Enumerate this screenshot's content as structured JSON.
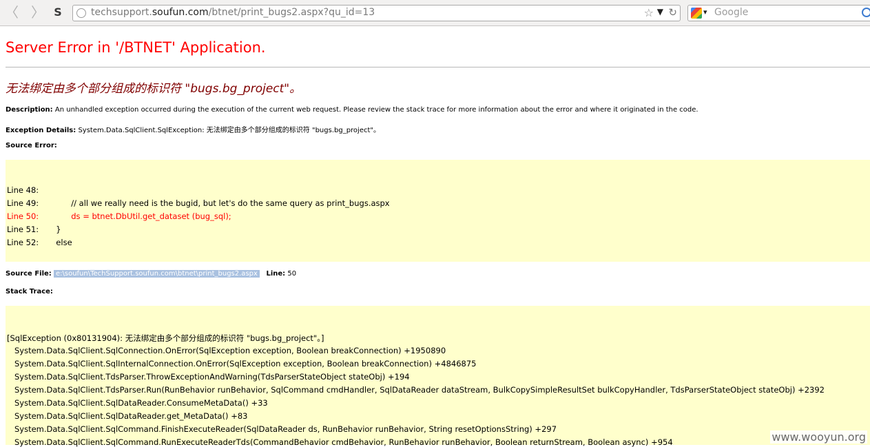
{
  "browser": {
    "url_prefix": "techsupport.",
    "url_host": "soufun.com",
    "url_path": "/btnet/print_bugs2.aspx?qu_id=13",
    "search_placeholder": "Google",
    "back_icon": "back-arrow-icon",
    "forward_icon": "forward-arrow-icon"
  },
  "page": {
    "title": "Server Error in '/BTNET' Application.",
    "error_heading": "无法绑定由多个部分组成的标识符 \"bugs.bg_project\"。",
    "description_label": "Description:",
    "description_text": "An unhandled exception occurred during the execution of the current web request. Please review the stack trace for more information about the error and where it originated in the code.",
    "exception_label": "Exception Details:",
    "exception_text": "System.Data.SqlClient.SqlException: 无法绑定由多个部分组成的标识符 \"bugs.bg_project\"。",
    "source_error_label": "Source Error:",
    "source_lines": [
      {
        "num": "Line 48:",
        "code": ""
      },
      {
        "num": "Line 49:",
        "code": "        // all we really need is the bugid, but let's do the same query as print_bugs.aspx"
      },
      {
        "num": "Line 50:",
        "code": "        ds = btnet.DbUtil.get_dataset (bug_sql);"
      },
      {
        "num": "Line 51:",
        "code": "  }"
      },
      {
        "num": "Line 52:",
        "code": "  else"
      }
    ],
    "source_file_label": "Source File:",
    "source_file_value": "e:\\soufun\\TechSupport.soufun.com\\btnet\\print_bugs2.aspx",
    "line_label": "Line:",
    "line_value": "50",
    "stack_trace_label": "Stack Trace:",
    "stack_lines": [
      "[SqlException (0x80131904): 无法绑定由多个部分组成的标识符 \"bugs.bg_project\"。]",
      "   System.Data.SqlClient.SqlConnection.OnError(SqlException exception, Boolean breakConnection) +1950890",
      "   System.Data.SqlClient.SqlInternalConnection.OnError(SqlException exception, Boolean breakConnection) +4846875",
      "   System.Data.SqlClient.TdsParser.ThrowExceptionAndWarning(TdsParserStateObject stateObj) +194",
      "   System.Data.SqlClient.TdsParser.Run(RunBehavior runBehavior, SqlCommand cmdHandler, SqlDataReader dataStream, BulkCopySimpleResultSet bulkCopyHandler, TdsParserStateObject stateObj) +2392",
      "   System.Data.SqlClient.SqlDataReader.ConsumeMetaData() +33",
      "   System.Data.SqlClient.SqlDataReader.get_MetaData() +83",
      "   System.Data.SqlClient.SqlCommand.FinishExecuteReader(SqlDataReader ds, RunBehavior runBehavior, String resetOptionsString) +297",
      "   System.Data.SqlClient.SqlCommand.RunExecuteReaderTds(CommandBehavior cmdBehavior, RunBehavior runBehavior, Boolean returnStream, Boolean async) +954"
    ],
    "watermark": "www.wooyun.org"
  }
}
